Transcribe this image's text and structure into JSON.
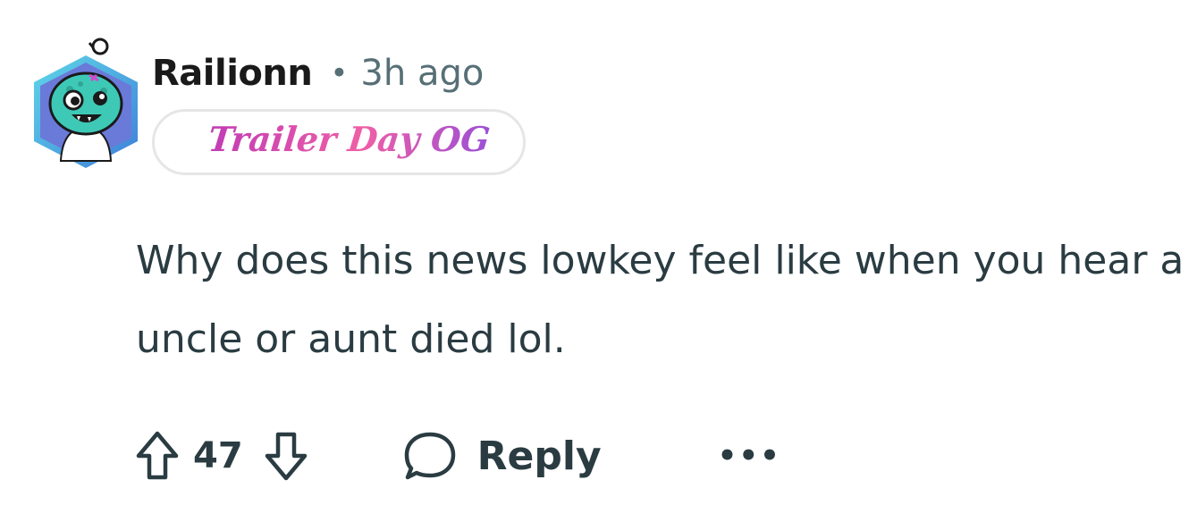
{
  "comment": {
    "author": "Railionn",
    "separator": "•",
    "timestamp": "3h ago",
    "flair": "Trailer Day OG",
    "body": "Why does this news lowkey feel like when you hear a uncle or aunt died lol.",
    "score": "47",
    "reply_label": "Reply",
    "more_label": "•••"
  },
  "icons": {
    "avatar": "avatar-icon",
    "upvote": "upvote-arrow-icon",
    "downvote": "downvote-arrow-icon",
    "reply": "speech-bubble-icon",
    "more": "ellipsis-icon"
  },
  "colors": {
    "text_primary": "#1a1a1b",
    "text_secondary": "#576f76",
    "body_text": "#2a3c42",
    "flair_pink": "#d94fae",
    "flair_border": "#e6e6e6",
    "avatar_teal": "#3ec9b6"
  }
}
